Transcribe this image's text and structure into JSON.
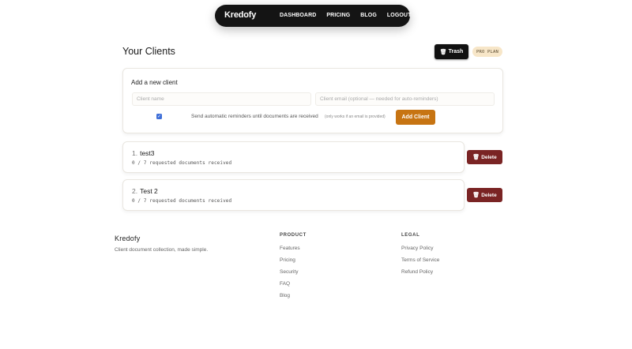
{
  "nav": {
    "brand": "Kredofy",
    "links": [
      "DASHBOARD",
      "PRICING",
      "BLOG",
      "LOGOUT"
    ]
  },
  "page": {
    "title": "Your Clients",
    "trash_label": "Trash",
    "trash_icon": "trash-icon",
    "plan_badge": "PRO PLAN"
  },
  "add_client": {
    "heading": "Add a new client",
    "name_placeholder": "Client name",
    "email_placeholder": "Client email (optional — needed for auto-reminders)",
    "reminder_label": "Send automatic reminders until documents are received",
    "reminder_note": "(only works if an email is provided)",
    "reminder_checked": true,
    "submit_label": "Add Client"
  },
  "clients": [
    {
      "index": "1.",
      "name": "test3",
      "status": "0 / 7 requested documents received",
      "delete_label": "Delete"
    },
    {
      "index": "2.",
      "name": "Test 2",
      "status": "0 / 7 requested documents received",
      "delete_label": "Delete"
    }
  ],
  "footer": {
    "brand": "Kredofy",
    "tagline": "Client document collection, made simple.",
    "product_title": "PRODUCT",
    "product_links": [
      "Features",
      "Pricing",
      "Security",
      "FAQ",
      "Blog"
    ],
    "legal_title": "LEGAL",
    "legal_links": [
      "Privacy Policy",
      "Terms of Service",
      "Refund Policy"
    ]
  },
  "colors": {
    "nav_bg": "#141414",
    "accent": "#c77412",
    "danger": "#7a2424",
    "badge_bg": "#f7e6c8",
    "checkbox": "#3f6fd8"
  }
}
